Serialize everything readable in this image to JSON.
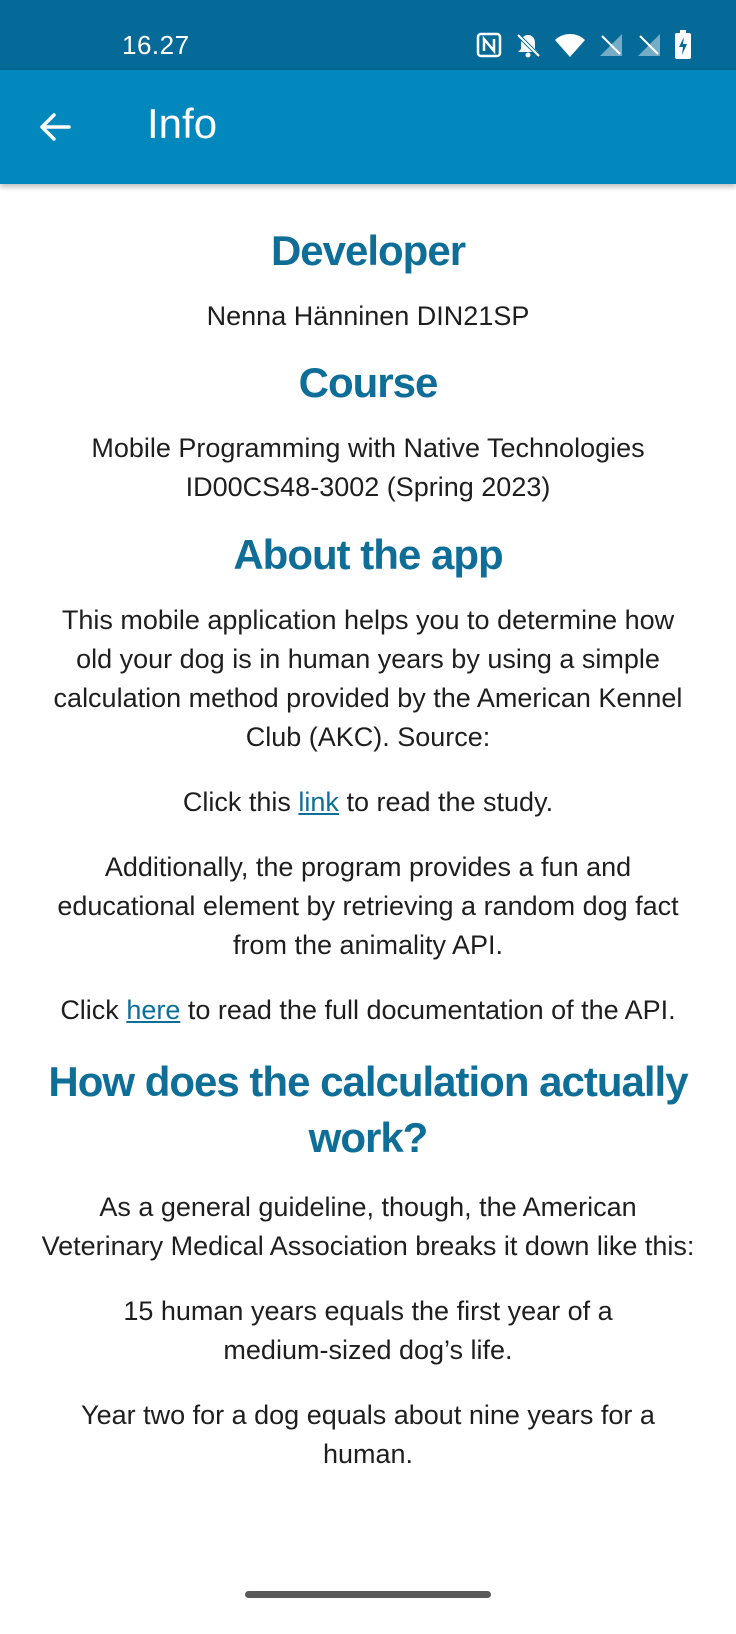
{
  "status_bar": {
    "time": "16.27",
    "icons": [
      "nfc-icon",
      "bell-off-icon",
      "wifi-icon",
      "signal-sim1-icon",
      "signal-sim2-icon",
      "battery-charging-icon"
    ]
  },
  "app_bar": {
    "back_icon": "arrow-left-icon",
    "title": "Info"
  },
  "content": {
    "developer_heading": "Developer",
    "developer_text": "Nenna Hänninen DIN21SP",
    "course_heading": "Course",
    "course_line1": "Mobile Programming with Native Technologies",
    "course_line2": "ID00CS48-3002 (Spring 2023)",
    "about_heading": "About the app",
    "about_text": "This mobile application helps you to determine how old your dog is in human years by using a simple calculation method provided by the American Kennel Club (AKC). Source:",
    "study_before": "Click this ",
    "study_link": "link",
    "study_after": " to read the study.",
    "fact_text": "Additionally, the program provides a fun and educational element by retrieving a random dog fact from the animality API.",
    "docs_before": "Click ",
    "docs_link": "here",
    "docs_after": " to read the full documentation of the API.",
    "calc_heading": "How does the calculation actually work?",
    "calc_text": "As a general guideline, though, the American Veterinary Medical Association breaks it down like this:",
    "rule1": "15 human years equals the first year of a medium-sized dog’s life.",
    "rule2": "Year two for a dog equals about nine years for a human."
  },
  "colors": {
    "status_bar": "#056a97",
    "app_bar": "#0288bd",
    "heading": "#0e6e97",
    "link": "#0d6f98"
  }
}
